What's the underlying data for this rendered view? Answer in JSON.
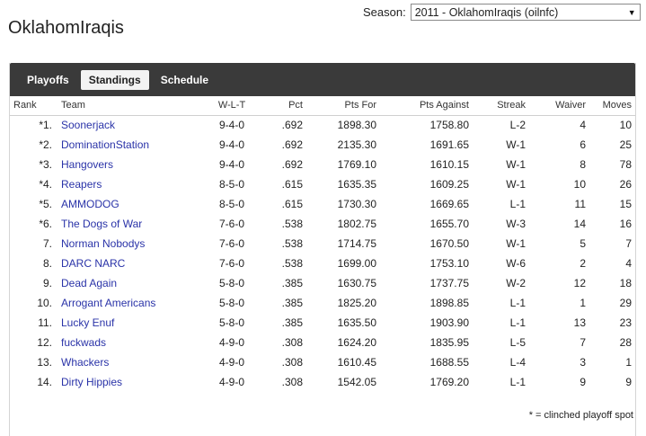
{
  "season": {
    "label": "Season:",
    "selected": "2011 - OklahomIraqis (oilnfc)"
  },
  "league": {
    "title": "OklahomIraqis"
  },
  "tabs": [
    {
      "label": "Playoffs",
      "active": false
    },
    {
      "label": "Standings",
      "active": true
    },
    {
      "label": "Schedule",
      "active": false
    }
  ],
  "table": {
    "headers": {
      "rank": "Rank",
      "team": "Team",
      "wlt": "W-L-T",
      "pct": "Pct",
      "pts_for": "Pts For",
      "pts_against": "Pts Against",
      "streak": "Streak",
      "waiver": "Waiver",
      "moves": "Moves"
    },
    "rows": [
      {
        "rank": "*1.",
        "team": "Soonerjack",
        "wlt": "9-4-0",
        "pct": ".692",
        "pts_for": "1898.30",
        "pts_against": "1758.80",
        "streak": "L-2",
        "waiver": "4",
        "moves": "10"
      },
      {
        "rank": "*2.",
        "team": "DominationStation",
        "wlt": "9-4-0",
        "pct": ".692",
        "pts_for": "2135.30",
        "pts_against": "1691.65",
        "streak": "W-1",
        "waiver": "6",
        "moves": "25"
      },
      {
        "rank": "*3.",
        "team": "Hangovers",
        "wlt": "9-4-0",
        "pct": ".692",
        "pts_for": "1769.10",
        "pts_against": "1610.15",
        "streak": "W-1",
        "waiver": "8",
        "moves": "78"
      },
      {
        "rank": "*4.",
        "team": "Reapers",
        "wlt": "8-5-0",
        "pct": ".615",
        "pts_for": "1635.35",
        "pts_against": "1609.25",
        "streak": "W-1",
        "waiver": "10",
        "moves": "26"
      },
      {
        "rank": "*5.",
        "team": "AMMODOG",
        "wlt": "8-5-0",
        "pct": ".615",
        "pts_for": "1730.30",
        "pts_against": "1669.65",
        "streak": "L-1",
        "waiver": "11",
        "moves": "15"
      },
      {
        "rank": "*6.",
        "team": "The Dogs of War",
        "wlt": "7-6-0",
        "pct": ".538",
        "pts_for": "1802.75",
        "pts_against": "1655.70",
        "streak": "W-3",
        "waiver": "14",
        "moves": "16"
      },
      {
        "rank": "7.",
        "team": "Norman Nobodys",
        "wlt": "7-6-0",
        "pct": ".538",
        "pts_for": "1714.75",
        "pts_against": "1670.50",
        "streak": "W-1",
        "waiver": "5",
        "moves": "7"
      },
      {
        "rank": "8.",
        "team": "DARC NARC",
        "wlt": "7-6-0",
        "pct": ".538",
        "pts_for": "1699.00",
        "pts_against": "1753.10",
        "streak": "W-6",
        "waiver": "2",
        "moves": "4"
      },
      {
        "rank": "9.",
        "team": "Dead Again",
        "wlt": "5-8-0",
        "pct": ".385",
        "pts_for": "1630.75",
        "pts_against": "1737.75",
        "streak": "W-2",
        "waiver": "12",
        "moves": "18"
      },
      {
        "rank": "10.",
        "team": "Arrogant Americans",
        "wlt": "5-8-0",
        "pct": ".385",
        "pts_for": "1825.20",
        "pts_against": "1898.85",
        "streak": "L-1",
        "waiver": "1",
        "moves": "29"
      },
      {
        "rank": "11.",
        "team": "Lucky Enuf",
        "wlt": "5-8-0",
        "pct": ".385",
        "pts_for": "1635.50",
        "pts_against": "1903.90",
        "streak": "L-1",
        "waiver": "13",
        "moves": "23"
      },
      {
        "rank": "12.",
        "team": "fuckwads",
        "wlt": "4-9-0",
        "pct": ".308",
        "pts_for": "1624.20",
        "pts_against": "1835.95",
        "streak": "L-5",
        "waiver": "7",
        "moves": "28"
      },
      {
        "rank": "13.",
        "team": "Whackers",
        "wlt": "4-9-0",
        "pct": ".308",
        "pts_for": "1610.45",
        "pts_against": "1688.55",
        "streak": "L-4",
        "waiver": "3",
        "moves": "1"
      },
      {
        "rank": "14.",
        "team": "Dirty Hippies",
        "wlt": "4-9-0",
        "pct": ".308",
        "pts_for": "1542.05",
        "pts_against": "1769.20",
        "streak": "L-1",
        "waiver": "9",
        "moves": "9"
      }
    ]
  },
  "footnote": "* = clinched playoff spot",
  "colors": {
    "tabbar_bg": "#3a3a3a",
    "team_link": "#2a33a8"
  }
}
